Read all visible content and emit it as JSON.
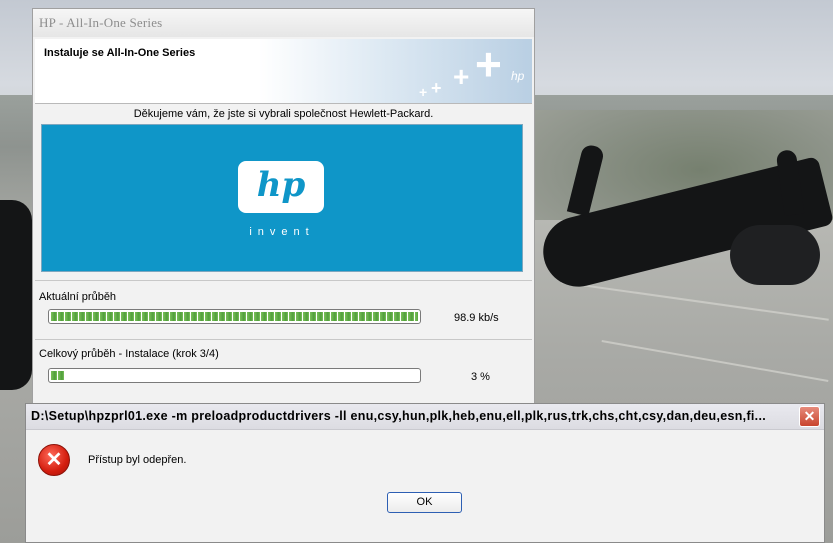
{
  "installer": {
    "title": "HP - All-In-One Series",
    "banner_title": "Instaluje se All-In-One Series",
    "banner_logo_text": "hp",
    "thanks_text": "Děkujeme vám, že jste si vybrali společnost Hewlett-Packard.",
    "hp_logo_text": "hp",
    "hp_tagline": "invent",
    "current_progress": {
      "label": "Aktuální průběh",
      "value": "98.9 kb/s",
      "fill_fraction": 1.0
    },
    "overall_progress": {
      "label": "Celkový průběh - Instalace (krok 3/4)",
      "value": "3 %",
      "fill_fraction": 0.03
    }
  },
  "error_dialog": {
    "title": "D:\\Setup\\hpzprl01.exe -m preloadproductdrivers -ll enu,csy,hun,plk,heb,enu,ell,plk,rus,trk,chs,cht,csy,dan,deu,esn,fi...",
    "message": "Přístup byl odepřen.",
    "ok_label": "OK",
    "close_glyph": "✕",
    "icon": "error-icon",
    "icon_glyph": "✕"
  },
  "colors": {
    "hp_blue": "#0f96c8",
    "progress_green": "#4f9d3a",
    "close_red": "#c9452e"
  }
}
